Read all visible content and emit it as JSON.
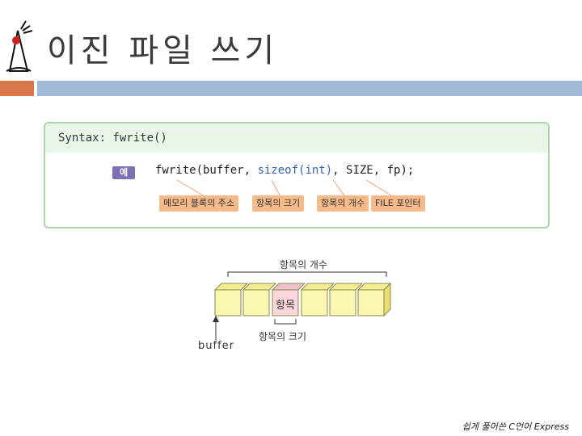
{
  "slide": {
    "title": "이진 파일 쓰기",
    "footer": "쉽게 풀어쓴 C언어 Express"
  },
  "syntax_box": {
    "heading": "Syntax: fwrite()",
    "example_badge": "예",
    "code": {
      "fn": "fwrite(buffer, ",
      "kw": "sizeof(int)",
      "rest": ", SIZE, fp);"
    },
    "tags": [
      "메모리 블록의 주소",
      "항목의 크기",
      "항목의 개수",
      "FILE 포인터"
    ]
  },
  "diagram": {
    "count_label": "항목의 개수",
    "item_label": "항목",
    "size_label": "항목의 크기",
    "pointer_label": "buffer"
  },
  "colors": {
    "accent_orange": "#d8784a",
    "accent_blue": "#9fb9d6",
    "box_border": "#aad6a8",
    "tag_fill": "#f6b98a",
    "badge_fill": "#7d6fb6",
    "block_fill": "#fbf7b0",
    "item_fill": "#f8d6dc"
  }
}
